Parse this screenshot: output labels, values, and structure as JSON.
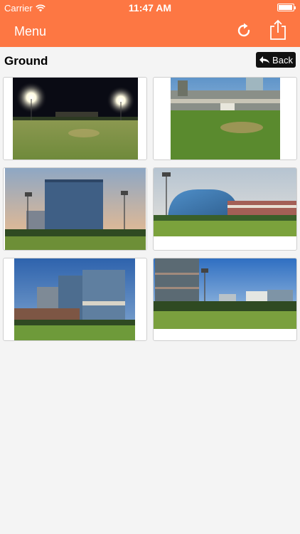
{
  "status": {
    "carrier": "Carrier",
    "time": "11:47 AM"
  },
  "nav": {
    "menu_label": "Menu"
  },
  "page": {
    "title": "Ground",
    "back_label": "Back"
  },
  "colors": {
    "accent": "#fd7743",
    "back_button": "#111111"
  },
  "icons": [
    "wifi-icon",
    "battery-icon",
    "refresh-icon",
    "share-icon",
    "back-arrow-icon"
  ],
  "gallery": [
    {
      "scene": "night-floodlit-ground"
    },
    {
      "scene": "pavilion-green-field"
    },
    {
      "scene": "glass-tower-ground"
    },
    {
      "scene": "dome-building-ground"
    },
    {
      "scene": "office-block-ground"
    },
    {
      "scene": "towers-ground-wide"
    }
  ]
}
